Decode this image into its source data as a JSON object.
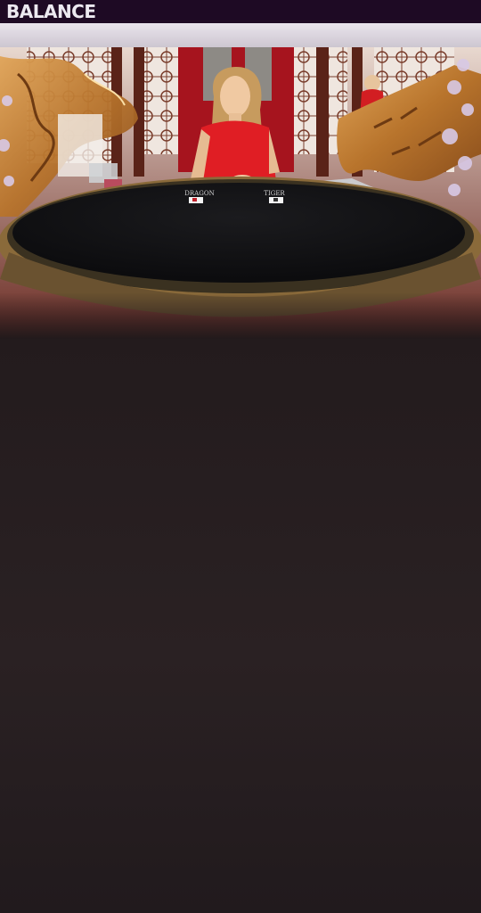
{
  "header": {
    "balance_label": "BALANCE"
  },
  "table": {
    "dragon_label": "DRAGON",
    "tiger_label": "TIGER"
  }
}
